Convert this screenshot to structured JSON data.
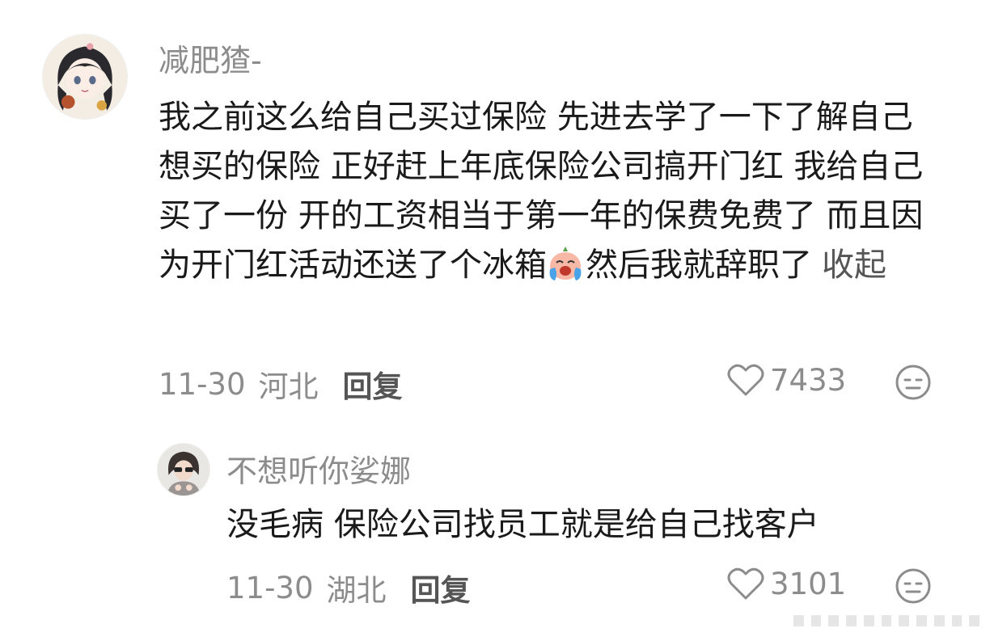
{
  "comments": [
    {
      "username": "减肥猹-",
      "text_before_emoji": "我之前这么给自己买过保险 先进去学了一下了解自己想买的保险 正好赶上年底保险公司搞开门红 我给自己买了一份 开的工资相当于第一年的保费免费了 而且因为开门红活动还送了个冰箱",
      "emoji": "crying-laugh-emoji",
      "text_after_emoji": "然后我就辞职了",
      "collapse_label": "收起",
      "date": "11-30",
      "location": "河北",
      "reply_label": "回复",
      "like_count": "7433"
    },
    {
      "username": "不想听你娑娜",
      "text": "没毛病 保险公司找员工就是给自己找客户",
      "date": "11-30",
      "location": "湖北",
      "reply_label": "回复",
      "like_count": "3101"
    }
  ],
  "colors": {
    "username": "#8c8c8c",
    "body": "#1a1a1a",
    "action": "#555555"
  }
}
